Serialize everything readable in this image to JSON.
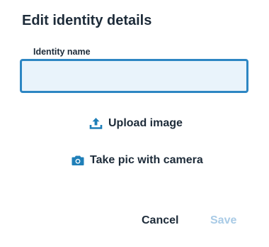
{
  "dialog": {
    "title": "Edit identity details",
    "name_label": "Identity name",
    "name_value": "",
    "name_placeholder": "",
    "upload_label": "Upload image",
    "upload_icon": "upload-icon",
    "camera_label": "Take pic with camera",
    "camera_icon": "camera-icon",
    "cancel_label": "Cancel",
    "save_label": "Save",
    "save_enabled": false
  },
  "colors": {
    "text": "#1d2b39",
    "accent": "#2d86c3",
    "input_bg": "#e9f3fb",
    "disabled": "#a9cbe6",
    "icon": "#1f7fb8"
  }
}
